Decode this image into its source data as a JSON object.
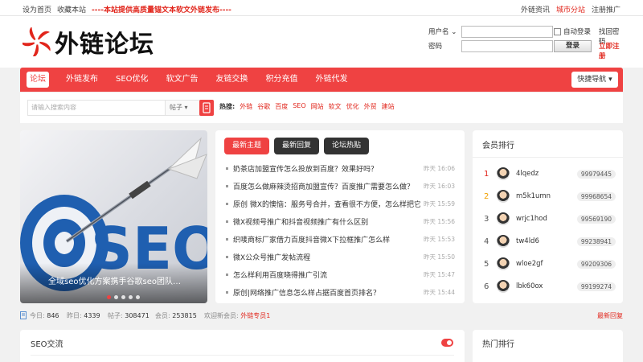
{
  "topbar": {
    "home": "设为首页",
    "bookmark": "收藏本站",
    "notice": "----本站提供高质量锚文本软文外链发布----",
    "links": [
      "外链资讯",
      "城市分站",
      "注册推广"
    ]
  },
  "logo": {
    "text": "外链论坛"
  },
  "login": {
    "username_label": "用户名",
    "password_label": "密码",
    "auto_login": "自动登录",
    "find_password": "找回密码",
    "login_button": "登录",
    "register": "立即注册"
  },
  "nav": {
    "items": [
      "论坛",
      "外链发布",
      "SEO优化",
      "软文广告",
      "友链交换",
      "积分充值",
      "外链代发"
    ],
    "quick": "快捷导航"
  },
  "search": {
    "placeholder": "请输入搜索内容",
    "type": "帖子",
    "hot_label": "热搜:",
    "hot_words": [
      "外链",
      "谷歌",
      "百度",
      "SEO",
      "网站",
      "软文",
      "优化",
      "外贸",
      "建站"
    ]
  },
  "banner": {
    "caption": "全域seo优化方案携手谷歌seo团队…",
    "slides": 5,
    "active_slide": 1
  },
  "posts": {
    "tabs": [
      "最新主题",
      "最新回复",
      "论坛热贴"
    ],
    "items": [
      {
        "title": "奶茶店加盟宣传怎么投放到百度？效果好吗？",
        "time": "昨天 16:06"
      },
      {
        "title": "百度怎么做麻辣烫招商加盟宣传？百度推广需要怎么做？",
        "time": "昨天 16:03"
      },
      {
        "title": "原创 微X的懊恼：服务号合并，查看很不方便，怎么样把它调到首页",
        "time": "昨天 15:59"
      },
      {
        "title": "微X视频号推广和抖音视频推广有什么区别",
        "time": "昨天 15:56"
      },
      {
        "title": "织唛商标厂家借力百度抖音微X下拉框推广怎么样",
        "time": "昨天 15:53"
      },
      {
        "title": "微X公众号推广发帖流程",
        "time": "昨天 15:50"
      },
      {
        "title": "怎么样利用百度晓得推广引流",
        "time": "昨天 15:47"
      },
      {
        "title": "原创|网络推广信息怎么样占据百度首页排名？",
        "time": "昨天 15:44"
      }
    ]
  },
  "rank": {
    "title": "会员排行",
    "members": [
      {
        "no": "1",
        "name": "4lqedz",
        "points": "99979445"
      },
      {
        "no": "2",
        "name": "m5k1umn",
        "points": "99968654"
      },
      {
        "no": "3",
        "name": "wrjc1hod",
        "points": "99569190"
      },
      {
        "no": "4",
        "name": "tw4ld6",
        "points": "99238941"
      },
      {
        "no": "5",
        "name": "wloe2gf",
        "points": "99209306"
      },
      {
        "no": "6",
        "name": "lbk60ox",
        "points": "99199274"
      }
    ]
  },
  "stats": {
    "today_label": "今日:",
    "today": "846",
    "yesterday_label": "昨日:",
    "yesterday": "4339",
    "posts_label": "帖子:",
    "posts": "308471",
    "members_label": "会员:",
    "members": "253815",
    "welcome_label": "欢迎新会员:",
    "welcome_name": "外链专员1",
    "newest": "最新回复"
  },
  "sections": {
    "seo": "SEO交流",
    "hot_rank": "热门排行"
  },
  "colors": {
    "brand": "#ef4242",
    "text_red": "#e1251b"
  }
}
